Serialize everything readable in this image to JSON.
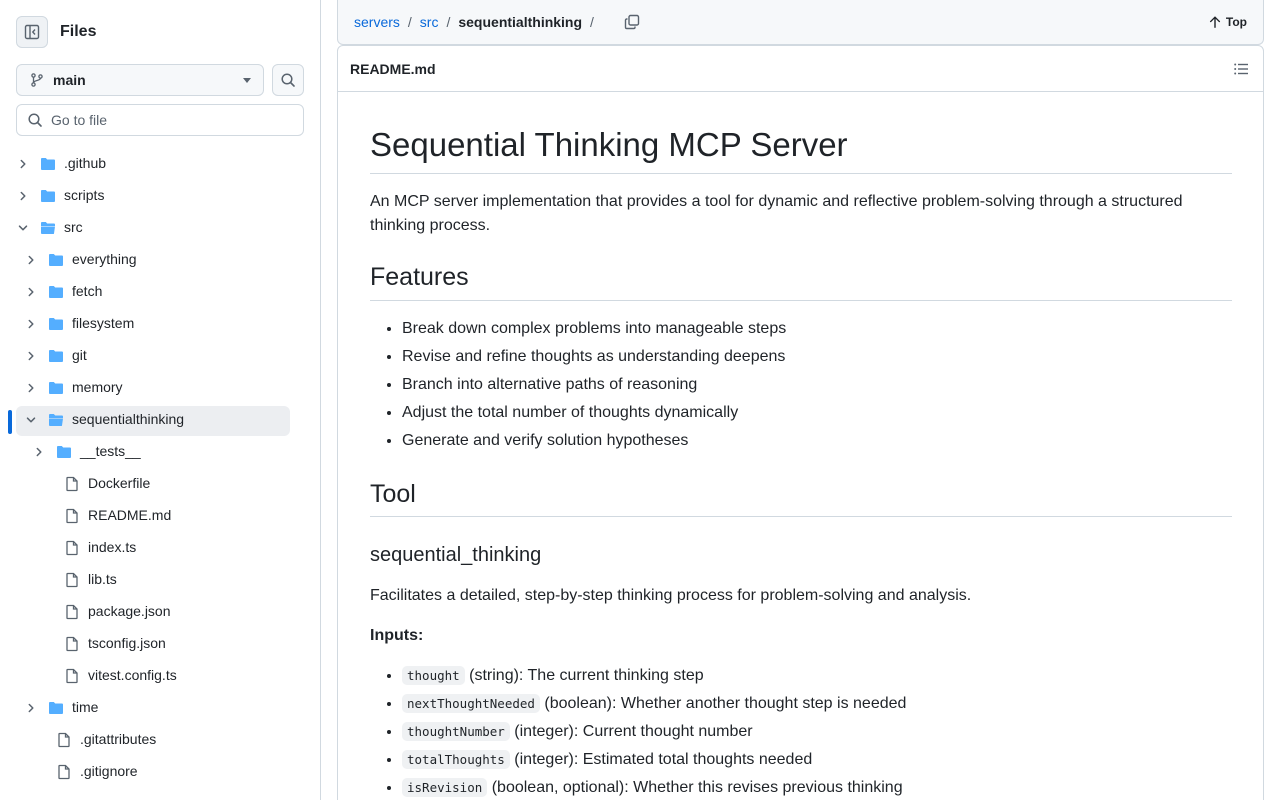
{
  "sidebar": {
    "title": "Files",
    "branch": "main",
    "goto_placeholder": "Go to file",
    "tree": [
      {
        "label": ".github",
        "type": "folder",
        "depth": 0,
        "expanded": false
      },
      {
        "label": "scripts",
        "type": "folder",
        "depth": 0,
        "expanded": false
      },
      {
        "label": "src",
        "type": "folder",
        "depth": 0,
        "expanded": true
      },
      {
        "label": "everything",
        "type": "folder",
        "depth": 1,
        "expanded": false
      },
      {
        "label": "fetch",
        "type": "folder",
        "depth": 1,
        "expanded": false
      },
      {
        "label": "filesystem",
        "type": "folder",
        "depth": 1,
        "expanded": false
      },
      {
        "label": "git",
        "type": "folder",
        "depth": 1,
        "expanded": false
      },
      {
        "label": "memory",
        "type": "folder",
        "depth": 1,
        "expanded": false
      },
      {
        "label": "sequentialthinking",
        "type": "folder",
        "depth": 1,
        "expanded": true,
        "selected": true
      },
      {
        "label": "__tests__",
        "type": "folder",
        "depth": 2,
        "expanded": false
      },
      {
        "label": "Dockerfile",
        "type": "file",
        "depth": 2
      },
      {
        "label": "README.md",
        "type": "file",
        "depth": 2
      },
      {
        "label": "index.ts",
        "type": "file",
        "depth": 2
      },
      {
        "label": "lib.ts",
        "type": "file",
        "depth": 2
      },
      {
        "label": "package.json",
        "type": "file",
        "depth": 2
      },
      {
        "label": "tsconfig.json",
        "type": "file",
        "depth": 2
      },
      {
        "label": "vitest.config.ts",
        "type": "file",
        "depth": 2
      },
      {
        "label": "time",
        "type": "folder",
        "depth": 1,
        "expanded": false
      },
      {
        "label": ".gitattributes",
        "type": "file",
        "depth": 1
      },
      {
        "label": ".gitignore",
        "type": "file",
        "depth": 1
      }
    ]
  },
  "breadcrumb": {
    "items": [
      "servers",
      "src"
    ],
    "separator": "/",
    "current": "sequentialthinking"
  },
  "top_button": "Top",
  "file": {
    "name": "README.md"
  },
  "readme": {
    "title": "Sequential Thinking MCP Server",
    "intro": "An MCP server implementation that provides a tool for dynamic and reflective problem-solving through a structured thinking process.",
    "features_heading": "Features",
    "features": [
      "Break down complex problems into manageable steps",
      "Revise and refine thoughts as understanding deepens",
      "Branch into alternative paths of reasoning",
      "Adjust the total number of thoughts dynamically",
      "Generate and verify solution hypotheses"
    ],
    "tool_heading": "Tool",
    "tool_name": "sequential_thinking",
    "tool_desc": "Facilitates a detailed, step-by-step thinking process for problem-solving and analysis.",
    "inputs_label": "Inputs:",
    "inputs": [
      {
        "code": "thought",
        "desc": " (string): The current thinking step"
      },
      {
        "code": "nextThoughtNeeded",
        "desc": " (boolean): Whether another thought step is needed"
      },
      {
        "code": "thoughtNumber",
        "desc": " (integer): Current thought number"
      },
      {
        "code": "totalThoughts",
        "desc": " (integer): Estimated total thoughts needed"
      },
      {
        "code": "isRevision",
        "desc": " (boolean, optional): Whether this revises previous thinking"
      }
    ]
  },
  "colors": {
    "accent": "#0969da",
    "folder": "#54aeff",
    "muted": "#59636e",
    "border": "#d1d9e0"
  }
}
